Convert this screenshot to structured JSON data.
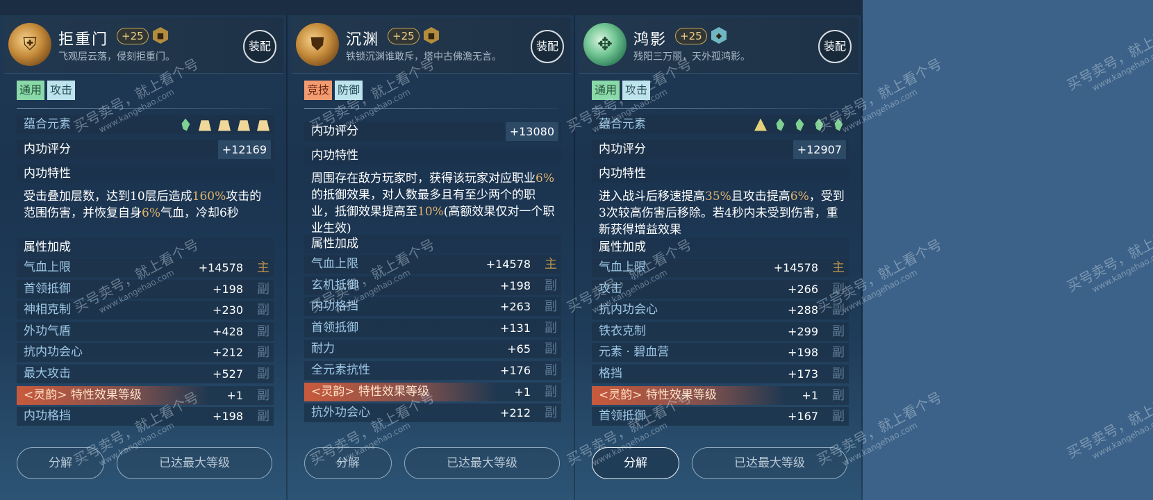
{
  "cards": [
    {
      "name": "拒重门",
      "level": "+25",
      "desc": "飞观层云落，侵刻拒重门。",
      "equip_label": "装配",
      "tags": [
        "通用",
        "攻击"
      ],
      "element_label": "蕴合元素",
      "elements": [
        "wind",
        "earth",
        "earth",
        "earth",
        "earth"
      ],
      "score_label": "内功评分",
      "score": "+12169",
      "trait_label": "内功特性",
      "effect": [
        {
          "t": "受击叠加层数，达到10层后造成"
        },
        {
          "t": "160%",
          "h": true
        },
        {
          "t": "攻击的范围伤害，并恢复自身"
        },
        {
          "t": "6%",
          "h": true
        },
        {
          "t": "气血，冷却6秒"
        }
      ],
      "attr_label": "属性加成",
      "attrs": [
        {
          "name": "气血上限",
          "value": "+14578",
          "role": "主"
        },
        {
          "name": "首领抵御",
          "value": "+198",
          "role": "副"
        },
        {
          "name": "神相克制",
          "value": "+230",
          "role": "副"
        },
        {
          "name": "外功气盾",
          "value": "+428",
          "role": "副"
        },
        {
          "name": "抗内功会心",
          "value": "+212",
          "role": "副"
        },
        {
          "name": "最大攻击",
          "value": "+527",
          "role": "副"
        },
        {
          "name": "<灵韵> 特性效果等级",
          "value": "+1",
          "role": "副",
          "special": true
        },
        {
          "name": "内功格挡",
          "value": "+198",
          "role": "副"
        }
      ],
      "decompose_label": "分解",
      "max_label": "已达最大等级"
    },
    {
      "name": "沉渊",
      "level": "+25",
      "desc": "铁锁沉渊谁敢斥，塔中古佛澹无言。",
      "equip_label": "装配",
      "tags": [
        "竞技",
        "防御"
      ],
      "score_label": "内功评分",
      "score": "+13080",
      "trait_label": "内功特性",
      "effect": [
        {
          "t": "周围存在敌方玩家时，获得该玩家对应职业"
        },
        {
          "t": "6%",
          "h": true
        },
        {
          "t": "的抵御效果，对人数最多且有至少两个的职业，抵御效果提高至"
        },
        {
          "t": "10%",
          "h": true
        },
        {
          "t": "(高额效果仅对一个职业生效)"
        }
      ],
      "attr_label": "属性加成",
      "attrs": [
        {
          "name": "气血上限",
          "value": "+14578",
          "role": "主"
        },
        {
          "name": "玄机抵御",
          "value": "+198",
          "role": "副"
        },
        {
          "name": "内功格挡",
          "value": "+263",
          "role": "副"
        },
        {
          "name": "首领抵御",
          "value": "+131",
          "role": "副"
        },
        {
          "name": "耐力",
          "value": "+65",
          "role": "副"
        },
        {
          "name": "全元素抗性",
          "value": "+176",
          "role": "副"
        },
        {
          "name": "<灵韵> 特性效果等级",
          "value": "+1",
          "role": "副",
          "special": true
        },
        {
          "name": "抗外功会心",
          "value": "+212",
          "role": "副"
        }
      ],
      "decompose_label": "分解",
      "max_label": "已达最大等级"
    },
    {
      "name": "鸿影",
      "level": "+25",
      "desc": "残阳三万丽，天外孤鸿影。",
      "equip_label": "装配",
      "tags": [
        "通用",
        "攻击"
      ],
      "element_label": "蕴合元素",
      "elements": [
        "thunder",
        "wind",
        "wind",
        "wind",
        "wind"
      ],
      "score_label": "内功评分",
      "score": "+12907",
      "trait_label": "内功特性",
      "effect": [
        {
          "t": "进入战斗后移速提高"
        },
        {
          "t": "35%",
          "h": true
        },
        {
          "t": "且攻击提高"
        },
        {
          "t": "6%",
          "h": true
        },
        {
          "t": "，受到3次较高伤害后移除。若4秒内未受到伤害，重新获得增益效果"
        }
      ],
      "attr_label": "属性加成",
      "attrs": [
        {
          "name": "气血上限",
          "value": "+14578",
          "role": "主"
        },
        {
          "name": "攻击",
          "value": "+266",
          "role": "副"
        },
        {
          "name": "抗内功会心",
          "value": "+288",
          "role": "副"
        },
        {
          "name": "铁衣克制",
          "value": "+299",
          "role": "副"
        },
        {
          "name": "元素 · 碧血营",
          "value": "+198",
          "role": "副"
        },
        {
          "name": "格挡",
          "value": "+173",
          "role": "副"
        },
        {
          "name": "<灵韵> 特性效果等级",
          "value": "+1",
          "role": "副",
          "special": true
        },
        {
          "name": "首领抵御",
          "value": "+167",
          "role": "副"
        }
      ],
      "decompose_label": "分解",
      "max_label": "已达最大等级"
    }
  ],
  "watermark": {
    "text": "买号卖号，就上看个号",
    "url": "www.kangehao.com",
    "brand": "看个号"
  },
  "colors": {
    "highlight": "#e0b26d",
    "background": "#3d6289"
  }
}
